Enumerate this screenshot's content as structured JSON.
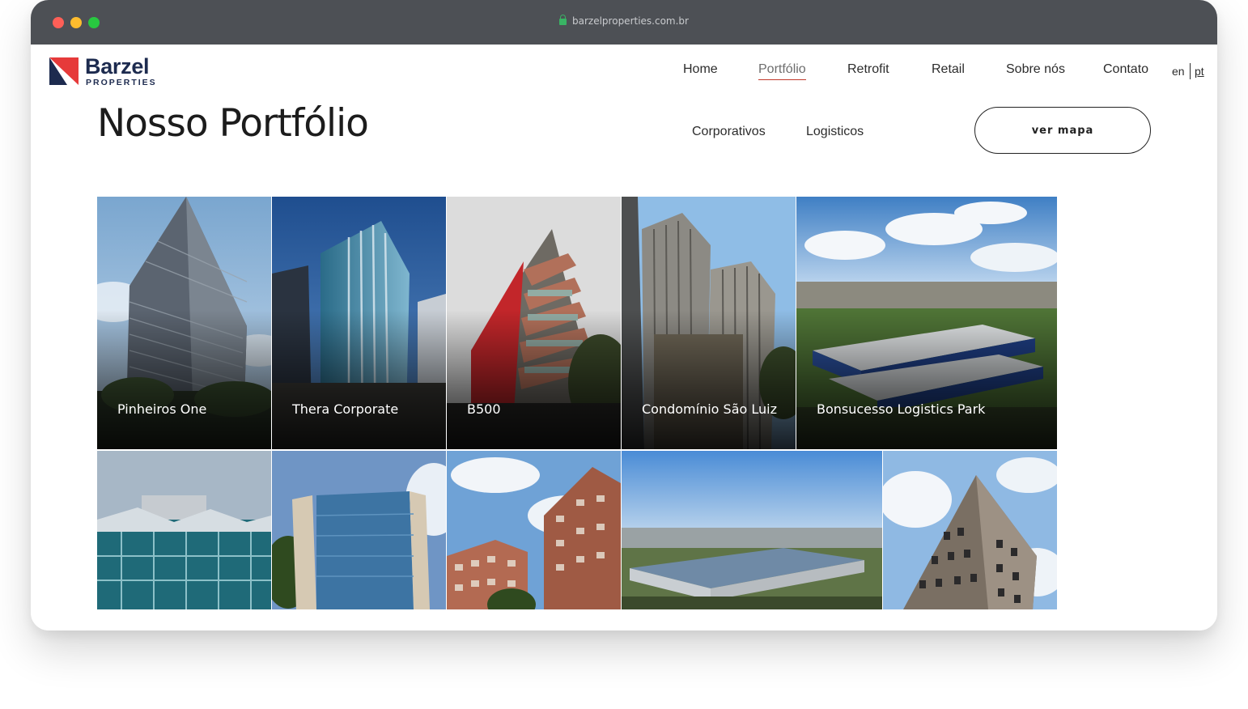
{
  "browser": {
    "url": "barzelproperties.com.br"
  },
  "brand": {
    "name": "Barzel",
    "sub": "PROPERTIES",
    "colors": {
      "red": "#e63a3a",
      "navy": "#1d2b4f"
    }
  },
  "nav": {
    "items": [
      {
        "label": "Home",
        "active": false
      },
      {
        "label": "Portfólio",
        "active": true
      },
      {
        "label": "Retrofit",
        "active": false
      },
      {
        "label": "Retail",
        "active": false
      },
      {
        "label": "Sobre nós",
        "active": false
      },
      {
        "label": "Contato",
        "active": false
      }
    ],
    "lang": {
      "en": "en",
      "pt": "pt",
      "selected": "pt"
    }
  },
  "page_title": "Nosso Portfólio",
  "filters": [
    "Corporativos",
    "Logisticos"
  ],
  "map_button": "ver mapa",
  "properties": [
    {
      "name": "Pinheiros One",
      "icon": "office-tower-icon"
    },
    {
      "name": "Thera Corporate",
      "icon": "glass-tower-icon"
    },
    {
      "name": "B500",
      "icon": "red-facade-tower-icon"
    },
    {
      "name": "Condomínio São Luiz",
      "icon": "twin-towers-icon"
    },
    {
      "name": "Bonsucesso Logistics Park",
      "icon": "warehouse-icon"
    },
    {
      "name": "",
      "icon": "glass-building-icon"
    },
    {
      "name": "",
      "icon": "blue-glass-building-icon"
    },
    {
      "name": "",
      "icon": "brick-towers-icon"
    },
    {
      "name": "",
      "icon": "logistics-warehouse-icon"
    },
    {
      "name": "",
      "icon": "grid-facade-tower-icon"
    }
  ]
}
